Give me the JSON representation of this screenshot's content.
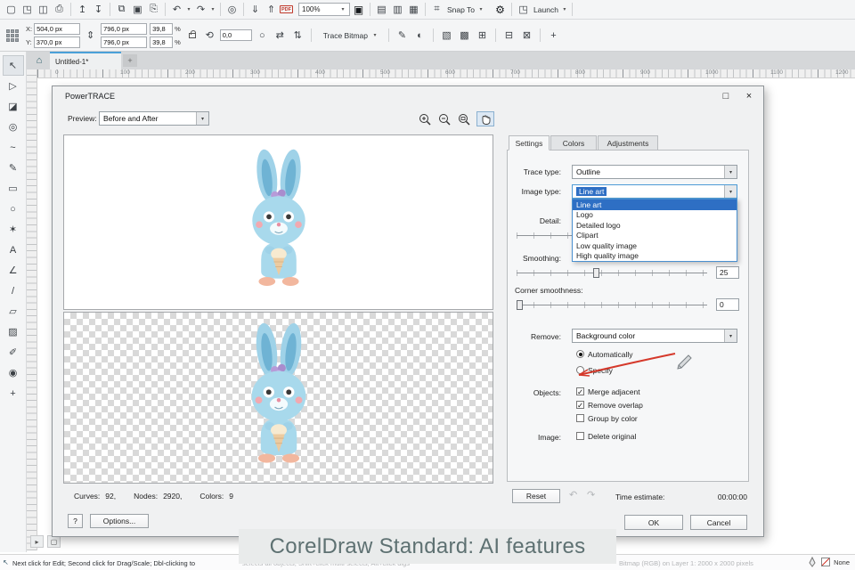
{
  "icons": {
    "new_document": "▢",
    "open": "◳",
    "save": "◫",
    "print": "⎙",
    "upload": "↥",
    "download": "↧",
    "copy": "⧉",
    "paste": "▣",
    "duplicate": "⎘",
    "undo": "↶",
    "redo": "↷",
    "dropdown": "▾",
    "search": "◎",
    "import": "⇓",
    "export": "⇑",
    "fullscreen": "▣",
    "view_simple": "▤",
    "view_enhanced": "▥",
    "view_pixels": "▦",
    "snap": "⌗",
    "gear": "⚙",
    "launch_glyph": "◳",
    "updown": "⇕",
    "rotate": "⟲",
    "ellipse_ref": "○",
    "mirror_h": "⇄",
    "mirror_v": "⇅",
    "edit": "✎",
    "adjust": "◐",
    "pattern": "▧",
    "border": "▩",
    "grid": "⊞",
    "frame": "⊟",
    "mesh": "⊠",
    "plus": "+",
    "home": "⌂",
    "cursor": "↖",
    "restore": "□",
    "close": "×",
    "check": "✓",
    "nav_arrow": "▸",
    "page": "▢"
  },
  "toolbox": {
    "pick": "↖",
    "shape": "▷",
    "crop": "◪",
    "zoom": "◎",
    "freehand": "~",
    "bezier": "✎",
    "rectangle": "▭",
    "ellipse": "○",
    "polygon": "✶",
    "text": "A",
    "dimension": "∠",
    "connector": "/",
    "shadow": "▱",
    "transparency": "▨",
    "eyedropper": "✐",
    "fill": "◉",
    "more": "+"
  },
  "toolbar": {
    "zoom_value": "100%",
    "snap_label": "Snap To",
    "launch_label": "Launch",
    "pdf_label": "PDF"
  },
  "prop_bar": {
    "x_label": "X:",
    "x_value": "504,0 px",
    "y_label": "Y:",
    "y_value": "370,0 px",
    "w_value": "796,0 px",
    "h_value": "796,0 px",
    "scale_x": "39,8",
    "scale_y": "39,8",
    "pct_x": "%",
    "pct_y": "%",
    "angle_value": "0,0",
    "trace_btn": "Trace Bitmap"
  },
  "tabbar": {
    "doc_tab": "Untitled-1*"
  },
  "ruler_numbers": [
    "0",
    "100",
    "200",
    "300",
    "400",
    "500",
    "600",
    "700",
    "800",
    "900",
    "1000",
    "1100",
    "1200"
  ],
  "dialog": {
    "title": "PowerTRACE",
    "preview_label": "Preview:",
    "preview_value": "Before and After",
    "stats": {
      "curves_label": "Curves:",
      "curves_value": "92,",
      "nodes_label": "Nodes:",
      "nodes_value": "2920,",
      "colors_label": "Colors:",
      "colors_value": "9"
    },
    "help_btn": "?",
    "options_btn": "Options...",
    "tabs": {
      "settings": "Settings",
      "colors": "Colors",
      "adjustments": "Adjustments"
    },
    "settings": {
      "trace_type_label": "Trace type:",
      "trace_type_value": "Outline",
      "image_type_label": "Image type:",
      "image_type_value": "Line art",
      "image_type_options": [
        "Line art",
        "Logo",
        "Detailed logo",
        "Clipart",
        "Low quality image",
        "High quality image"
      ],
      "detail_label": "Detail:",
      "smoothing_label": "Smoothing:",
      "smoothing_value": "25",
      "corner_label": "Corner smoothness:",
      "corner_value": "0",
      "remove_label": "Remove:",
      "remove_value": "Background color",
      "auto_label": "Automatically",
      "specify_label": "Specify",
      "objects_label": "Objects:",
      "merge_label": "Merge adjacent",
      "overlap_label": "Remove overlap",
      "group_label": "Group by color",
      "image_label": "Image:",
      "delete_label": "Delete original"
    },
    "footer": {
      "reset_btn": "Reset",
      "time_label": "Time estimate:",
      "time_value": "00:00:00",
      "ok_btn": "OK",
      "cancel_btn": "Cancel"
    }
  },
  "caption_text": "CorelDraw Standard: AI features",
  "status": {
    "hint_dark": "Next click for Edit; Second click for Drag/Scale; Dbl-clicking to",
    "hint_light": "selects all objects; Shift+click multi-selects; Alt+click digs",
    "object_info": "Bitmap (RGB) on Layer 1: 2000 x 2000 pixels",
    "fill_none": "None"
  }
}
